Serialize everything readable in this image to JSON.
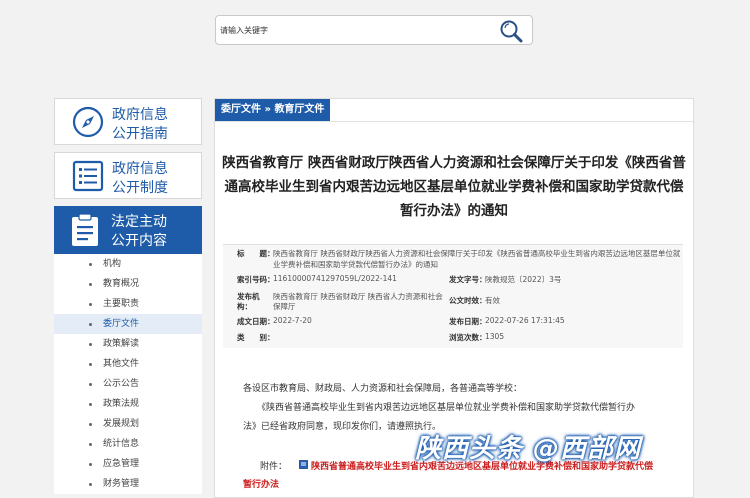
{
  "search": {
    "placeholder": "请输入关键字"
  },
  "sidebar": {
    "boxes": [
      {
        "line1": "政府信息",
        "line2": "公开指南"
      },
      {
        "line1": "政府信息",
        "line2": "公开制度"
      }
    ],
    "active": {
      "line1": "法定主动",
      "line2": "公开内容"
    },
    "items": [
      {
        "label": "机构"
      },
      {
        "label": "教育概况"
      },
      {
        "label": "主要职责"
      },
      {
        "label": "委厅文件"
      },
      {
        "label": "政策解读"
      },
      {
        "label": "其他文件"
      },
      {
        "label": "公示公告"
      },
      {
        "label": "政策法规"
      },
      {
        "label": "发展规划"
      },
      {
        "label": "统计信息"
      },
      {
        "label": "应急管理"
      },
      {
        "label": "财务管理"
      }
    ],
    "active_item_index": 3
  },
  "breadcrumb": {
    "first": "委厅文件",
    "sep": "»",
    "second": "教育厅文件"
  },
  "doc": {
    "title_line1": "陕西省教育厅 陕西省财政厅陕西省人力资源和社会保障厅关于印发《陕西省普",
    "title_line2": "通高校毕业生到省内艰苦边远地区基层单位就业学费补偿和国家助学贷款代偿",
    "title_line3": "暂行办法》的通知"
  },
  "meta": {
    "title_key": "标　　题：",
    "title_val_l1": "陕西省教育厅 陕西省财政厅陕西省人力资源和社会保障厅关于印发《陕西省普通高校毕业生到省内艰苦边远地区基层单位就",
    "title_val_l2": "业学费补偿和国家助学贷款代偿暂行办法》的通知",
    "index_key": "索引号码：",
    "index_val": "11610000741297059L/2022-141",
    "docno_key": "发文字号：",
    "docno_val": "陕教规范〔2022〕3号",
    "issuer_key": "发布机",
    "issuer_key2": "构：",
    "issuer_val_l1": "陕西省教育厅 陕西省财政厅 陕西省人力资源和社会",
    "issuer_val_l2": "保障厅",
    "validity_key": "公文时效：",
    "validity_val": "有效",
    "date_key": "成文日期：",
    "date_val": "2022-7-20",
    "pubdate_key": "发布日期：",
    "pubdate_val": "2022-07-26 17:31:45",
    "category_key": "类　　别：",
    "category_val": "",
    "views_key": "浏览次数：",
    "views_val": "1305"
  },
  "body": {
    "p1": "各设区市教育局、财政局、人力资源和社会保障局，各普通高等学校：",
    "p2_l1": "《陕西省普通高校毕业生到省内艰苦边远地区基层单位就业学费补偿和国家助学贷款代偿暂行办",
    "p2_l2": "法》已经省政府同意，现印发你们，请遵照执行。",
    "attach_label": "附件：",
    "attach_link_l1": "陕西省普通高校毕业生到省内艰苦边远地区基层单位就业学费补偿和国家助学贷款代偿",
    "attach_link_l2": "暂行办法"
  },
  "watermark": "陕西头条 @西部网",
  "colors": {
    "brand": "#1e5ba8",
    "link_red": "#cc1f1f",
    "page_bg": "#f2f2f2"
  }
}
